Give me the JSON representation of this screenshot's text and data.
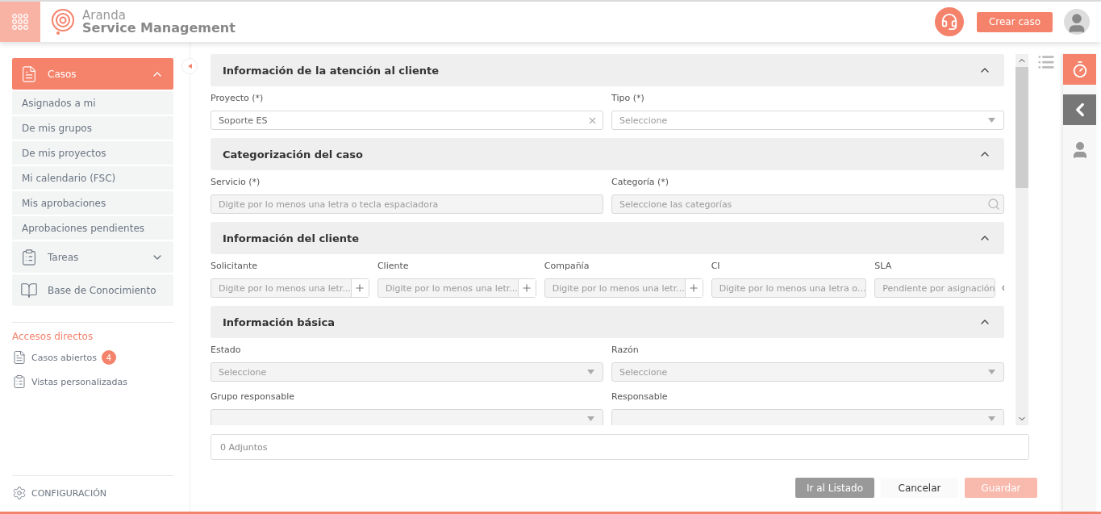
{
  "header": {
    "brand_top": "Aranda",
    "brand_bottom": "Service Management",
    "create_button": "Crear caso"
  },
  "sidebar": {
    "menu": [
      {
        "label": "Casos",
        "kind": "cases",
        "selected": true,
        "expanded": true,
        "children": [
          {
            "label": "Asignados a mi"
          },
          {
            "label": "De mis grupos"
          },
          {
            "label": "De mis proyectos"
          },
          {
            "label": "Mi calendario (FSC)"
          },
          {
            "label": "Mis aprobaciones"
          },
          {
            "label": "Aprobaciones pendientes"
          }
        ]
      },
      {
        "label": "Tareas",
        "kind": "tasks",
        "selected": false,
        "expanded": false
      },
      {
        "label": "Base de Conocimiento",
        "kind": "knowledge",
        "selected": false
      }
    ],
    "shortcuts_title": "Accesos directos",
    "shortcuts": [
      {
        "label": "Casos abiertos",
        "kind": "cases",
        "badge": "4"
      },
      {
        "label": "Vistas personalizadas",
        "kind": "views"
      }
    ],
    "settings": "CONFIGURACIÓN"
  },
  "form": {
    "sections": [
      {
        "title": "Información de la atención al cliente",
        "expanded": true,
        "fields": [
          {
            "label": "Proyecto (*)",
            "kind": "clear",
            "value": "Soporte ES",
            "disabled": false
          },
          {
            "label": "Tipo (*)",
            "kind": "select",
            "placeholder": "Seleccione",
            "disabled": false
          }
        ]
      },
      {
        "title": "Categorización del caso",
        "expanded": true,
        "fields": [
          {
            "label": "Servicio (*)",
            "kind": "text",
            "placeholder": "Digite por lo menos una letra o tecla espaciadora",
            "disabled": true
          },
          {
            "label": "Categoría (*)",
            "kind": "search",
            "placeholder": "Seleccione las categorías",
            "disabled": true
          }
        ]
      },
      {
        "title": "Información del cliente",
        "expanded": true,
        "fields": [
          {
            "label": "Solicitante",
            "kind": "add",
            "placeholder": "Digite por lo menos una letr...",
            "disabled": true
          },
          {
            "label": "Cliente",
            "kind": "add",
            "placeholder": "Digite por lo menos una letr...",
            "disabled": true
          },
          {
            "label": "Compañía",
            "kind": "add",
            "placeholder": "Digite por lo menos una letr...",
            "disabled": true
          },
          {
            "label": "CI",
            "kind": "text",
            "placeholder": "Digite por lo menos una letra o...",
            "disabled": true
          },
          {
            "label": "SLA",
            "kind": "view",
            "placeholder": "Pendiente por asignación",
            "disabled": true
          }
        ]
      },
      {
        "title": "Información básica",
        "expanded": true,
        "fields": [
          {
            "label": "Estado",
            "kind": "select",
            "placeholder": "Seleccione",
            "disabled": true
          },
          {
            "label": "Razón",
            "kind": "select",
            "placeholder": "Seleccione",
            "disabled": true
          },
          {
            "label": "Grupo responsable",
            "kind": "select",
            "disabled": true
          },
          {
            "label": "Responsable",
            "kind": "select",
            "disabled": true
          }
        ]
      }
    ],
    "attachments": "0 Adjuntos",
    "buttons": [
      {
        "label": "Ir al Listado",
        "kind": "secondary",
        "disabled": false
      },
      {
        "label": "Cancelar",
        "kind": "plain",
        "disabled": false
      },
      {
        "label": "Guardar",
        "kind": "primary",
        "disabled": true
      }
    ]
  }
}
